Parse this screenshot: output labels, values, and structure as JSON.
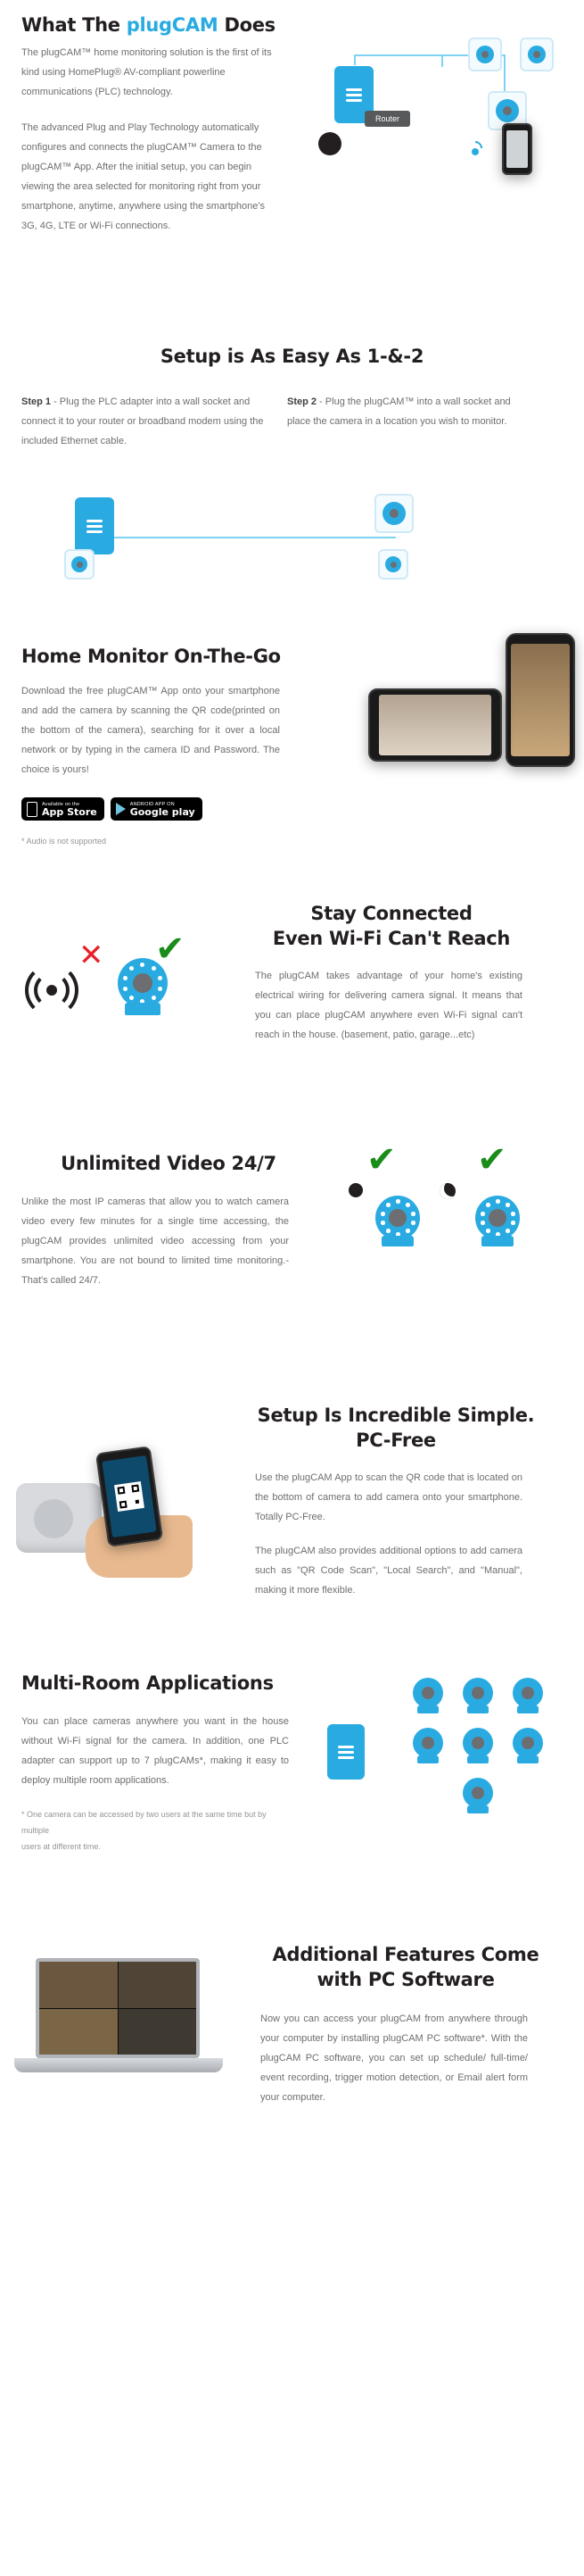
{
  "brand": {
    "accent": "#29abe2",
    "dark": "#231f20",
    "body_color": "#6d6e71"
  },
  "section1": {
    "title_pre": "What The ",
    "title_accent": "plugCAM",
    "title_post": " Does",
    "para1": "The plugCAM™ home monitoring solution is the first of its kind using HomePlug® AV-compliant powerline communications (PLC) technology.",
    "para2": "The advanced Plug and Play Technology automatically configures and connects the plugCAM™ Camera to the plugCAM™ App. After the initial setup, you can begin viewing the area selected for monitoring right from your smartphone, anytime, anywhere using the smartphone's 3G, 4G, LTE or Wi-Fi connections.",
    "router_label": "Router"
  },
  "section2": {
    "title": "Setup is As Easy As 1-&-2",
    "step1_label": "Step 1",
    "step1_text": " - Plug the PLC adapter into a wall socket and connect it to your router or broadband modem using the included Ethernet cable.",
    "step2_label": "Step 2",
    "step2_text": " - Plug the plugCAM™ into a wall socket and place the camera in a location you wish to monitor."
  },
  "section3": {
    "title": "Home Monitor On-The-Go",
    "para": "Download the free plugCAM™ App onto your smartphone and add the camera by scanning the QR code(printed on the bottom of the camera), searching for it over a local network or by typing in the camera ID and Password. The choice is yours!",
    "footnote": "* Audio is not supported",
    "appstore_small": "Available on the",
    "appstore_big": "App Store",
    "play_small": "ANDROID APP ON",
    "play_big": "Google play"
  },
  "section4": {
    "title_line1": "Stay Connected",
    "title_line2": "Even Wi-Fi Can't Reach",
    "para": "The plugCAM takes advantage of your home's existing electrical wiring for delivering camera signal. It means that you can place plugCAM anywhere even Wi-Fi signal can't reach in the house. (basement, patio, garage...etc)"
  },
  "section5": {
    "title": "Unlimited Video 24/7",
    "para": "Unlike the most IP cameras that allow you to watch camera video every few minutes for a single time accessing, the plugCAM provides unlimited video accessing from your smartphone. You are not bound to limited time monitoring.- That's called 24/7."
  },
  "section6": {
    "title_line1": "Setup Is Incredible Simple.",
    "title_line2": "PC-Free",
    "para1": "Use the plugCAM App to scan the QR code that is located on the bottom of camera to add camera onto your smartphone. Totally PC-Free.",
    "para2": "The plugCAM also provides additional options to add camera such as \"QR Code Scan\", \"Local Search\", and \"Manual\", making it more flexible."
  },
  "section7": {
    "title": "Multi-Room Applications",
    "para": "You can place cameras anywhere you want in the house without Wi-Fi signal for the camera. In addition, one PLC adapter can support up to 7 plugCAMs*, making it easy to deploy multiple room applications.",
    "footnote_line1": "* One camera can be accessed by two users at the same time but by multiple",
    "footnote_line2": "users at different time."
  },
  "section8": {
    "title_line1": "Additional Features Come",
    "title_line2": "with PC Software",
    "para": "Now you can access your plugCAM from anywhere through your computer by installing plugCAM PC software*. With the plugCAM PC software, you can set up schedule/ full-time/ event recording, trigger motion detection, or Email alert form your computer."
  }
}
